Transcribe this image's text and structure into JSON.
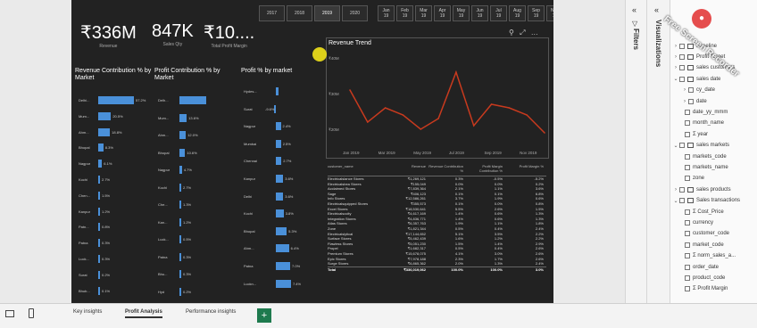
{
  "kpis": [
    {
      "value": "₹336M",
      "label": "Revenue"
    },
    {
      "value": "847K",
      "label": "Sales Qty"
    },
    {
      "value": "₹10....",
      "label": "Total Profit Margin"
    }
  ],
  "year_slicer": [
    "2017",
    "2018",
    "2019",
    "2020"
  ],
  "year_selected": "2019",
  "month_slicer": [
    {
      "m": "Jan",
      "y": "19"
    },
    {
      "m": "Feb",
      "y": "19"
    },
    {
      "m": "Mar",
      "y": "19"
    },
    {
      "m": "Apr",
      "y": "19"
    },
    {
      "m": "May",
      "y": "19"
    },
    {
      "m": "Jun",
      "y": "19"
    },
    {
      "m": "Jul",
      "y": "19"
    },
    {
      "m": "Aug",
      "y": "19"
    },
    {
      "m": "Sep",
      "y": "19"
    },
    {
      "m": "Nov",
      "y": "19"
    }
  ],
  "revenue_contribution": {
    "title": "Revenue Contribution % by Market",
    "rows": [
      {
        "name": "Delhi...",
        "pct": "57.2%",
        "v": 57.2
      },
      {
        "name": "Mum...",
        "pct": "20.5%",
        "v": 20.5
      },
      {
        "name": "Ahm...",
        "pct": "18.8%",
        "v": 18.8
      },
      {
        "name": "Bhopal",
        "pct": "8.3%",
        "v": 8.3
      },
      {
        "name": "Nagpur",
        "pct": "6.1%",
        "v": 6.1
      },
      {
        "name": "Kochi",
        "pct": "2.7%",
        "v": 2.7
      },
      {
        "name": "Chen...",
        "pct": "1.5%",
        "v": 1.5
      },
      {
        "name": "Kanpur",
        "pct": "1.2%",
        "v": 1.2
      },
      {
        "name": "Patn...",
        "pct": "0.8%",
        "v": 0.8
      },
      {
        "name": "Patna",
        "pct": "0.3%",
        "v": 0.3
      },
      {
        "name": "Luck...",
        "pct": "0.3%",
        "v": 0.3
      },
      {
        "name": "Surat",
        "pct": "0.2%",
        "v": 0.2
      },
      {
        "name": "Bhub...",
        "pct": "0.1%",
        "v": 0.1
      }
    ]
  },
  "profit_contribution": {
    "title": "Profit Contribution % by Market",
    "rows": [
      {
        "name": "Delh...",
        "pct": "",
        "v": 50
      },
      {
        "name": "Mum...",
        "pct": "13.6%",
        "v": 13.6
      },
      {
        "name": "Ahm...",
        "pct": "12.0%",
        "v": 12.0
      },
      {
        "name": "Bhopal",
        "pct": "10.6%",
        "v": 10.6
      },
      {
        "name": "Nagpur",
        "pct": "4.7%",
        "v": 4.7
      },
      {
        "name": "Kochi",
        "pct": "2.7%",
        "v": 2.7
      },
      {
        "name": "Che...",
        "pct": "1.3%",
        "v": 1.3
      },
      {
        "name": "Kan...",
        "pct": "1.2%",
        "v": 1.2
      },
      {
        "name": "Luck...",
        "pct": "0.5%",
        "v": 0.5
      },
      {
        "name": "Patna",
        "pct": "0.3%",
        "v": 0.3
      },
      {
        "name": "Bhu...",
        "pct": "0.3%",
        "v": 0.3
      },
      {
        "name": "Hyd",
        "pct": "0.2%",
        "v": 0.2
      }
    ]
  },
  "profit_pct_market": {
    "title": "Profit % by market",
    "rows": [
      {
        "name": "Hydes...",
        "pct": "",
        "v": 1.2
      },
      {
        "name": "Surat",
        "pct": "-9.6%",
        "v": -9.6
      },
      {
        "name": "Nagpur",
        "pct": "2.4%",
        "v": 2.4
      },
      {
        "name": "Mumbai",
        "pct": "2.5%",
        "v": 2.5
      },
      {
        "name": "Chennai",
        "pct": "2.7%",
        "v": 2.7
      },
      {
        "name": "Kanpur",
        "pct": "3.6%",
        "v": 3.6
      },
      {
        "name": "Delhi",
        "pct": "3.6%",
        "v": 3.6
      },
      {
        "name": "Kochi",
        "pct": "3.8%",
        "v": 3.8
      },
      {
        "name": "Bhopal",
        "pct": "5.3%",
        "v": 5.3
      },
      {
        "name": "Ahm...",
        "pct": "6.4%",
        "v": 6.4
      },
      {
        "name": "Patna",
        "pct": "7.0%",
        "v": 7.0
      },
      {
        "name": "Luckn...",
        "pct": "7.4%",
        "v": 7.4
      }
    ]
  },
  "chart_data": {
    "type": "line",
    "title": "Revenue Trend",
    "x": [
      "Jan 2019",
      "Feb 2019",
      "Mar 2019",
      "Apr 2019",
      "May 2019",
      "Jun 2019",
      "Jul 2019",
      "Aug 2019",
      "Sep 2019",
      "Oct 2019",
      "Nov 2019",
      "Dec 2019"
    ],
    "x_tick_labels": [
      "Jan 2019",
      "Mar 2019",
      "May 2019",
      "Jul 2019",
      "Sep 2019",
      "Nov 2019"
    ],
    "y_tick_labels": [
      "₹40M",
      "₹30M",
      "₹20M"
    ],
    "ylim": [
      15,
      42
    ],
    "values": [
      31,
      22,
      26,
      24,
      20,
      23,
      36,
      21,
      27,
      26,
      24,
      19
    ],
    "color": "#c83a1e"
  },
  "table": {
    "headers": [
      "customer_name",
      "Revenue",
      "Revenue Contribution %",
      "Profit Margin Contribution %",
      "Profit Margin %"
    ],
    "rows": [
      [
        "Electricalslance Stores",
        "₹1,269,121",
        "0.3%",
        "-0.5%",
        "-5.2%"
      ],
      [
        "Electricalsbea Stores",
        "₹155,049",
        "0.0%",
        "0.0%",
        "0.2%"
      ],
      [
        "Acclaimed Stores",
        "₹7,839,364",
        "2.1%",
        "1.1%",
        "3.6%"
      ],
      [
        "Sage",
        "₹406,123",
        "0.1%",
        "0.1%",
        "6.8%"
      ],
      [
        "Info Stores",
        "₹12,586,261",
        "3.7%",
        "1.9%",
        "0.6%"
      ],
      [
        "Electricalsquipped Stores",
        "₹355,573",
        "0.1%",
        "0.0%",
        "0.8%"
      ],
      [
        "Excel Stores",
        "₹18,530,641",
        "5.5%",
        "2.6%",
        "1.5%"
      ],
      [
        "Electricalsocity",
        "₹4,617,169",
        "1.4%",
        "0.6%",
        "1.3%"
      ],
      [
        "Integration Stores",
        "₹4,836,771",
        "1.4%",
        "0.6%",
        "1.3%"
      ],
      [
        "Atlas Stores",
        "₹6,357,763",
        "1.9%",
        "1.1%",
        "1.8%"
      ],
      [
        "Zone",
        "₹1,821,344",
        "0.5%",
        "0.4%",
        "2.4%"
      ],
      [
        "Electricalslytical",
        "₹17,144,652",
        "5.1%",
        "3.5%",
        "2.2%"
      ],
      [
        "Surface Stores",
        "₹5,462,439",
        "1.6%",
        "1.2%",
        "2.2%"
      ],
      [
        "Flawless Stores",
        "₹5,051,230",
        "1.5%",
        "1.4%",
        "2.9%"
      ],
      [
        "Propel",
        "₹1,682,317",
        "0.5%",
        "0.4%",
        "2.6%"
      ],
      [
        "Premium Stores",
        "₹15,678,075",
        "4.1%",
        "3.0%",
        "2.6%"
      ],
      [
        "Epic Stores",
        "₹7,978,188",
        "2.3%",
        "1.7%",
        "2.6%"
      ],
      [
        "Surge Stores",
        "₹6,865,362",
        "2.0%",
        "1.3%",
        "2.4%"
      ]
    ],
    "total": [
      "Total",
      "₹336,019,062",
      "100.0%",
      "100.0%",
      "3.0%"
    ]
  },
  "panes": {
    "filters": "Filters",
    "visualizations": "Visualizations"
  },
  "fields": [
    {
      "kind": "table",
      "name": "Baseline",
      "expand": "›"
    },
    {
      "kind": "table",
      "name": "Profit Target",
      "expand": "›"
    },
    {
      "kind": "table",
      "name": "sales customers",
      "expand": "›"
    },
    {
      "kind": "table",
      "name": "sales date",
      "expand": "⌄"
    },
    {
      "kind": "sub",
      "name": "cy_date",
      "expand": "›"
    },
    {
      "kind": "sub",
      "name": "date",
      "expand": "›"
    },
    {
      "kind": "field",
      "name": "date_yy_mmm"
    },
    {
      "kind": "field",
      "name": "month_name"
    },
    {
      "kind": "field",
      "name": "Σ year"
    },
    {
      "kind": "table",
      "name": "sales markets",
      "expand": "⌄"
    },
    {
      "kind": "field",
      "name": "markets_code"
    },
    {
      "kind": "field",
      "name": "markets_name"
    },
    {
      "kind": "field",
      "name": "zone"
    },
    {
      "kind": "table",
      "name": "sales products",
      "expand": "›"
    },
    {
      "kind": "table",
      "name": "Sales transactions",
      "expand": "⌄"
    },
    {
      "kind": "field",
      "name": "Σ Cost_Price"
    },
    {
      "kind": "field",
      "name": "currency"
    },
    {
      "kind": "field",
      "name": "customer_code"
    },
    {
      "kind": "field",
      "name": "market_code"
    },
    {
      "kind": "field",
      "name": "Σ norm_sales_a..."
    },
    {
      "kind": "field",
      "name": "order_date"
    },
    {
      "kind": "field",
      "name": "product_code"
    },
    {
      "kind": "field",
      "name": "Σ Profit Margin"
    }
  ],
  "page_tabs": [
    "Key insights",
    "Profit Analysis",
    "Performance insights"
  ],
  "active_tab": "Profit Analysis",
  "add_tab_label": "+",
  "watermark": "Free Screen Recorder",
  "rec_badge": "●"
}
